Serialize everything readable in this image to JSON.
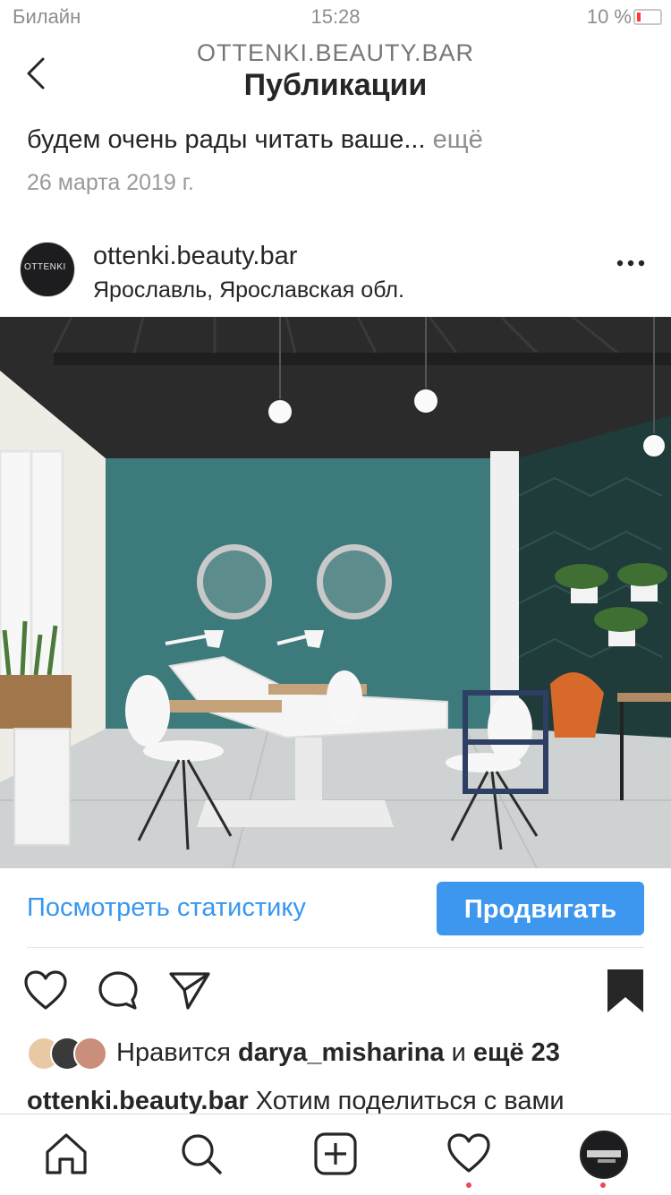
{
  "status_bar": {
    "carrier": "Билайн",
    "time": "15:28",
    "battery": "10 %"
  },
  "header": {
    "account": "OTTENKI.BEAUTY.BAR",
    "title": "Публикации"
  },
  "previous_post": {
    "caption_line": "будем очень рады читать ваше...",
    "more_label": "ещё",
    "date": "26 марта 2019 г."
  },
  "post": {
    "username": "ottenki.beauty.bar",
    "location": "Ярославль, Ярославская обл.",
    "avatar_text": "OTTENKI",
    "stats_label": "Посмотреть статистику",
    "promote_label": "Продвигать",
    "likes": {
      "prefix": "Нравится",
      "user": "darya_misharina",
      "connector": "и",
      "rest": "ещё 23"
    },
    "caption": {
      "username": "ottenki.beauty.bar",
      "text": "Хотим поделиться с вами"
    }
  },
  "colors": {
    "accent": "#3897f0",
    "promote_bg": "#3d97ee",
    "notification_dot": "#ed4956",
    "wall_teal": "#3d7a7c"
  },
  "icons": [
    "back-icon",
    "more-icon",
    "heart-icon",
    "comment-icon",
    "share-icon",
    "bookmark-icon",
    "home-icon",
    "search-icon",
    "add-icon",
    "activity-icon",
    "profile-icon"
  ]
}
